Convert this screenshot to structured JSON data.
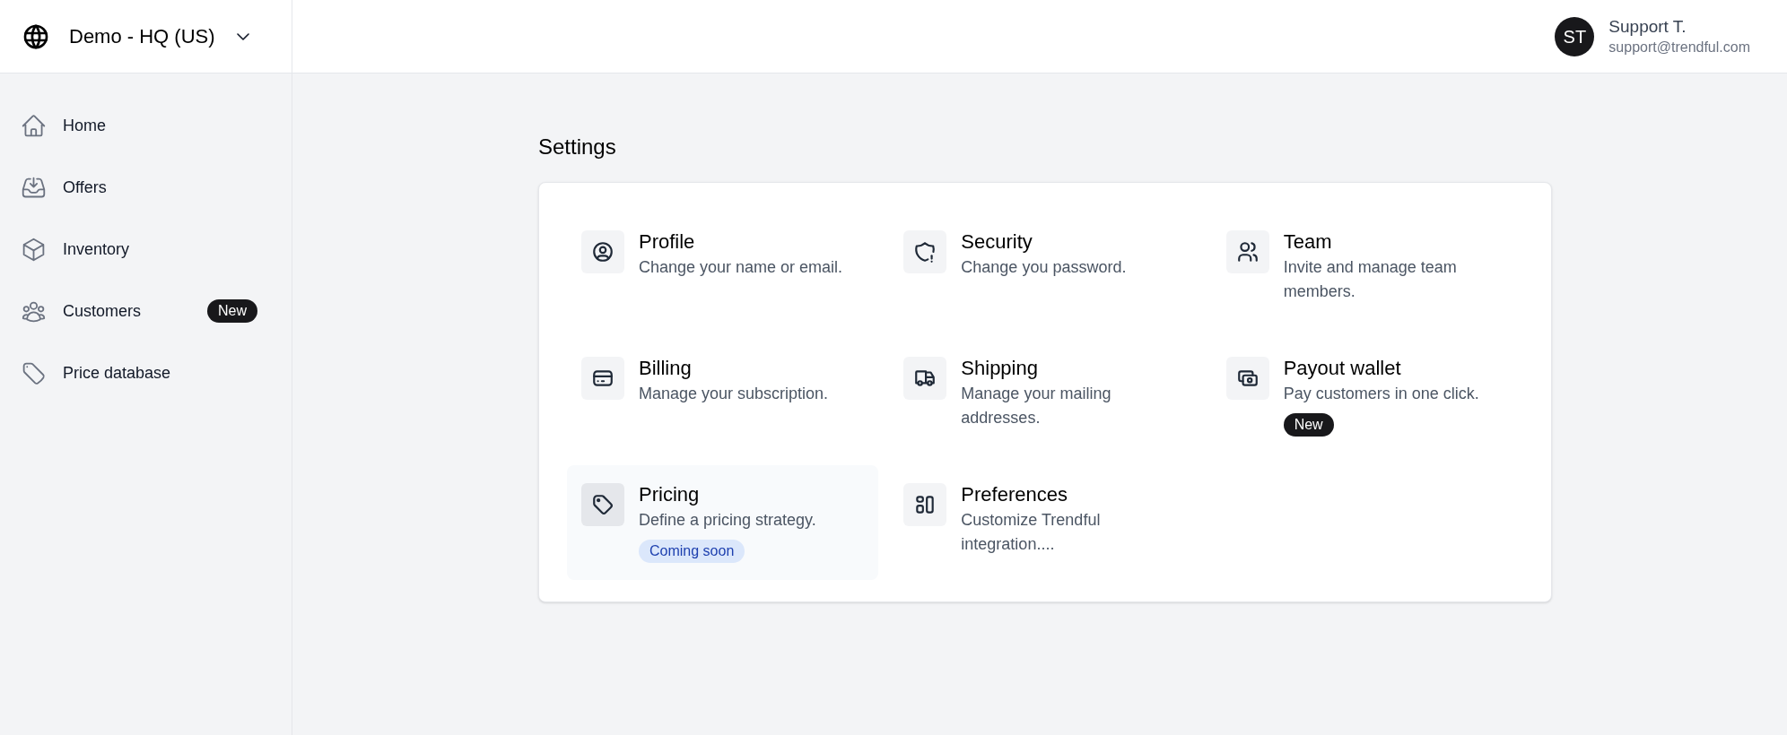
{
  "org_switcher": {
    "label": "Demo - HQ (US)"
  },
  "user": {
    "initials": "ST",
    "name": "Support T.",
    "email": "support@trendful.com"
  },
  "sidebar": {
    "items": [
      {
        "label": "Home",
        "selected": false
      },
      {
        "label": "Offers",
        "selected": false
      },
      {
        "label": "Inventory",
        "selected": false
      },
      {
        "label": "Customers",
        "selected": false,
        "badge": "New"
      },
      {
        "label": "Price database",
        "selected": false
      }
    ]
  },
  "page_title": "Settings",
  "settings": [
    {
      "title": "Profile",
      "description": "Change your name or email.",
      "selected": false
    },
    {
      "title": "Security",
      "description": "Change you password.",
      "selected": false
    },
    {
      "title": "Team",
      "description": "Invite and manage team members.",
      "selected": false
    },
    {
      "title": "Billing",
      "description": "Manage your subscription.",
      "selected": false
    },
    {
      "title": "Shipping",
      "description": "Manage your mailing addresses.",
      "selected": false
    },
    {
      "title": "Payout wallet",
      "description": "Pay customers in one click.",
      "selected": false,
      "badge": {
        "kind": "new",
        "label": "New"
      }
    },
    {
      "title": "Pricing",
      "description": "Define a pricing strategy.",
      "selected": true,
      "badge": {
        "kind": "coming_soon",
        "label": "Coming soon"
      }
    },
    {
      "title": "Preferences",
      "description": "Customize Trendful integration....",
      "selected": false
    }
  ]
}
